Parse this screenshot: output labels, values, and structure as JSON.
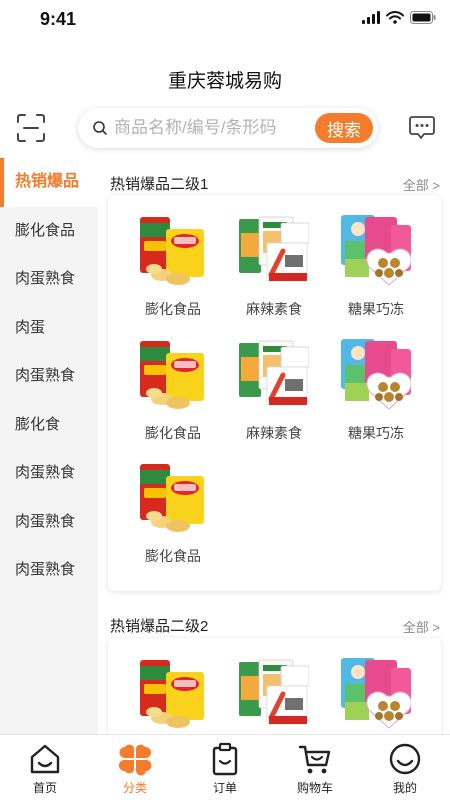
{
  "status": {
    "time": "9:41"
  },
  "header": {
    "title": "重庆蓉城易购"
  },
  "search": {
    "placeholder": "商品名称/编号/条形码",
    "button_label": "搜索"
  },
  "sidebar": {
    "items": [
      {
        "label": "热销爆品",
        "active": true
      },
      {
        "label": "膨化食品"
      },
      {
        "label": "肉蛋熟食"
      },
      {
        "label": "肉蛋"
      },
      {
        "label": "肉蛋熟食"
      },
      {
        "label": "膨化食"
      },
      {
        "label": "肉蛋熟食"
      },
      {
        "label": "肉蛋熟食"
      },
      {
        "label": "肉蛋熟食"
      }
    ]
  },
  "sections": [
    {
      "title": "热销爆品二级1",
      "more": "全部 >",
      "products": [
        {
          "name": "膨化食品",
          "icon": "chips-bag-icon"
        },
        {
          "name": "麻辣素食",
          "icon": "spicy-snack-box-icon"
        },
        {
          "name": "糖果巧冻",
          "icon": "candy-jelly-box-icon"
        },
        {
          "name": "膨化食品",
          "icon": "chips-bag-icon"
        },
        {
          "name": "麻辣素食",
          "icon": "spicy-snack-box-icon"
        },
        {
          "name": "糖果巧冻",
          "icon": "candy-jelly-box-icon"
        },
        {
          "name": "膨化食品",
          "icon": "chips-bag-icon"
        }
      ]
    },
    {
      "title": "热销爆品二级2",
      "more": "全部 >",
      "products": [
        {
          "name": "",
          "icon": "chips-bag-icon"
        },
        {
          "name": "",
          "icon": "spicy-snack-box-icon"
        },
        {
          "name": "",
          "icon": "candy-jelly-box-icon"
        }
      ]
    }
  ],
  "tabbar": {
    "items": [
      {
        "label": "首页",
        "icon": "home-icon"
      },
      {
        "label": "分类",
        "icon": "category-icon",
        "active": true
      },
      {
        "label": "订单",
        "icon": "order-clipboard-icon"
      },
      {
        "label": "购物车",
        "icon": "cart-icon"
      },
      {
        "label": "我的",
        "icon": "smiley-profile-icon"
      }
    ]
  },
  "colors": {
    "accent": "#f47c2c",
    "sidebar_bg": "#f4f4f4",
    "text": "#333333"
  }
}
